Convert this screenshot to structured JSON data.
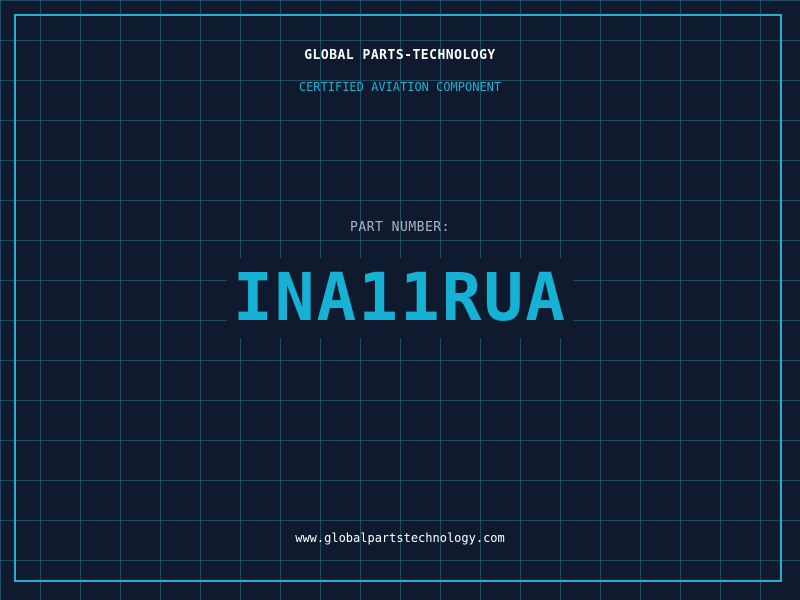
{
  "header": {
    "title": "GLOBAL PARTS-TECHNOLOGY",
    "subtitle": "CERTIFIED AVIATION COMPONENT"
  },
  "part": {
    "label": "PART NUMBER:",
    "number": "INA11RUA"
  },
  "footer": {
    "url": "www.globalpartstechnology.com"
  },
  "colors": {
    "background": "#0f1a2e",
    "grid": "#22788c",
    "accent": "#1fb1d2",
    "part_number": "#16b2d6",
    "label": "#aab6c6",
    "text": "#ffffff"
  }
}
